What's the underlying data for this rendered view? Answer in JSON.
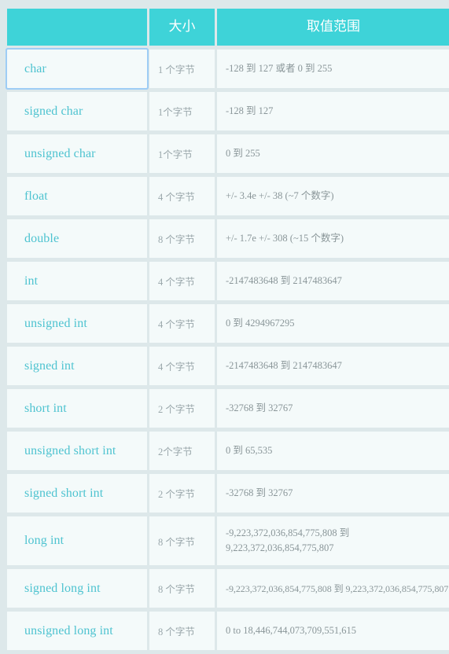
{
  "table": {
    "headers": {
      "type": "",
      "size": "大小",
      "range": "取值范围"
    },
    "rows": [
      {
        "type": "char",
        "size": "1 个字节",
        "range": "-128 到 127 或者 0 到 255",
        "focused": true
      },
      {
        "type": "signed char",
        "size": "1个字节",
        "range": "-128 到 127",
        "focused": false
      },
      {
        "type": "unsigned char",
        "size": "1个字节",
        "range": "0 到 255",
        "focused": false
      },
      {
        "type": "float",
        "size": "4 个字节",
        "range": "+/- 3.4e +/- 38 (~7 个数字)",
        "focused": false
      },
      {
        "type": "double",
        "size": "8 个字节",
        "range": "+/- 1.7e +/- 308 (~15 个数字)",
        "focused": false
      },
      {
        "type": "int",
        "size": "4 个字节",
        "range": "-2147483648 到 2147483647",
        "focused": false
      },
      {
        "type": "unsigned int",
        "size": "4 个字节",
        "range": "0 到 4294967295",
        "focused": false
      },
      {
        "type": "signed int",
        "size": "4 个字节",
        "range": "-2147483648 到 2147483647",
        "focused": false
      },
      {
        "type": "short int",
        "size": "2 个字节",
        "range": "-32768 到 32767",
        "focused": false
      },
      {
        "type": "unsigned short int",
        "size": "2个字节",
        "range": "0 到 65,535",
        "focused": false
      },
      {
        "type": "signed short int",
        "size": "2 个字节",
        "range": "-32768 到 32767",
        "focused": false
      },
      {
        "type": "long int",
        "size": "8 个字节",
        "range": "-9,223,372,036,854,775,808 到 9,223,372,036,854,775,807",
        "focused": false,
        "wrapped": true
      },
      {
        "type": "signed long int",
        "size": "8 个字节",
        "range": "-9,223,372,036,854,775,808 到 9,223,372,036,854,775,807",
        "focused": false,
        "tight": true
      },
      {
        "type": "unsigned long int",
        "size": "8 个字节",
        "range": "0 to 18,446,744,073,709,551,615",
        "focused": false
      }
    ]
  },
  "colors": {
    "header_background": "#3ed3d8",
    "header_text": "#ffffff",
    "page_background": "#dde8ea",
    "cell_background": "#f4fafa",
    "type_text": "#4ec3d0",
    "value_text": "#8a9699",
    "focus_border": "#9ecdf5"
  }
}
